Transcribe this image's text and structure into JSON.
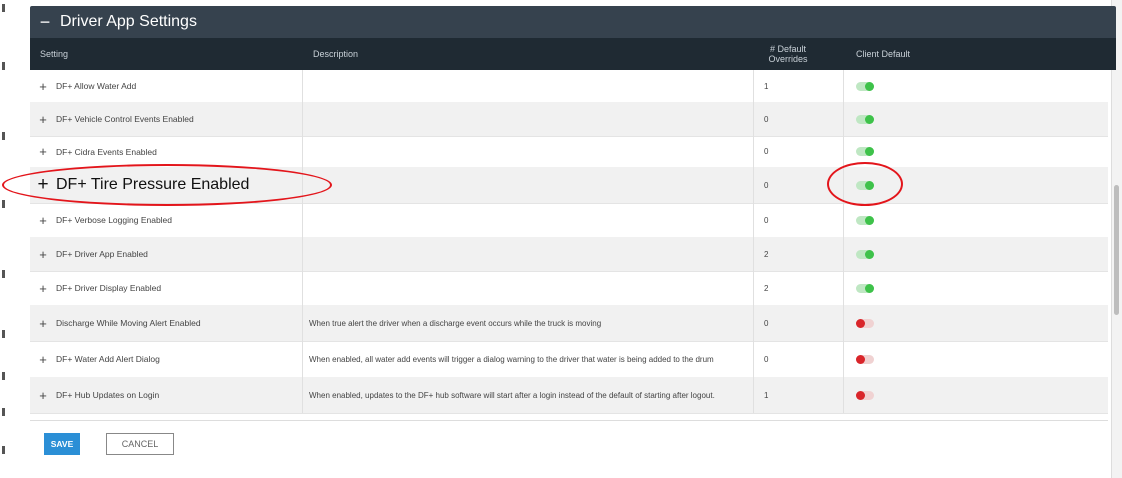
{
  "panel": {
    "collapse_symbol": "−",
    "title": "Driver App Settings"
  },
  "columns": {
    "setting": "Setting",
    "description": "Description",
    "overrides_line1": "# Default",
    "overrides_line2": "Overrides",
    "client_default": "Client Default"
  },
  "rows": [
    {
      "setting": "DF+ Allow Water Add",
      "description": "",
      "overrides": "1",
      "client_default": true
    },
    {
      "setting": "DF+ Vehicle Control Events Enabled",
      "description": "",
      "overrides": "0",
      "client_default": true
    },
    {
      "setting": "DF+ Cidra Events Enabled",
      "description": "",
      "overrides": "0",
      "client_default": true
    },
    {
      "setting": "DF+ Tire Pressure Enabled",
      "description": "",
      "overrides": "0",
      "client_default": true
    },
    {
      "setting": "DF+ Verbose Logging Enabled",
      "description": "",
      "overrides": "0",
      "client_default": true
    },
    {
      "setting": "DF+ Driver App Enabled",
      "description": "",
      "overrides": "2",
      "client_default": true
    },
    {
      "setting": "DF+ Driver Display Enabled",
      "description": "",
      "overrides": "2",
      "client_default": true
    },
    {
      "setting": "Discharge While Moving Alert Enabled",
      "description": "When true alert the driver when a discharge event occurs while the truck is moving",
      "overrides": "0",
      "client_default": false
    },
    {
      "setting": "DF+ Water Add Alert Dialog",
      "description": "When enabled, all water add events will trigger a dialog warning to the driver that water is being added to the drum",
      "overrides": "0",
      "client_default": false
    },
    {
      "setting": "DF+ Hub Updates on Login",
      "description": "When enabled, updates to the DF+ hub software will start after a login instead of the default of starting after logout.",
      "overrides": "1",
      "client_default": false
    }
  ],
  "row_expand_symbol": "+",
  "buttons": {
    "save": "SAVE",
    "cancel": "CANCEL"
  },
  "colors": {
    "header_bg": "#36424e",
    "column_header_bg": "#1f2a33",
    "toggle_on": "#3ec24a",
    "toggle_off": "#d9252a",
    "save_button": "#2b8fd6",
    "annotation": "#e3151b"
  },
  "icons": {
    "toggle_on": "toggle-on-icon",
    "toggle_off": "toggle-off-icon",
    "expand": "plus-icon",
    "collapse": "minus-icon"
  }
}
